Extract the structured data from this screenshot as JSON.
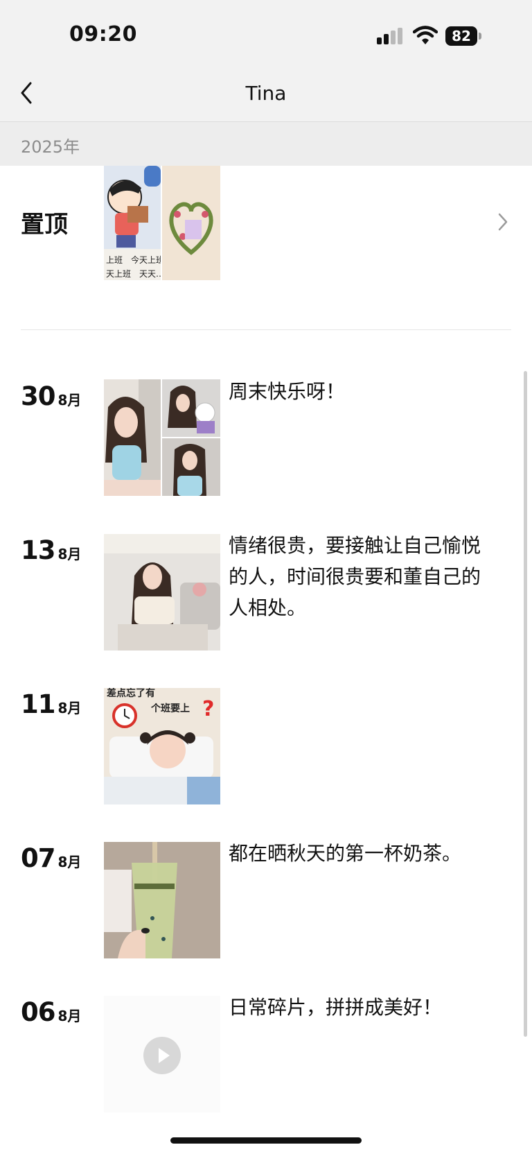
{
  "status_bar": {
    "time": "09:20",
    "battery": "82"
  },
  "nav": {
    "title": "Tina"
  },
  "year_header": "2025年",
  "pinned": {
    "label": "置顶",
    "thumb_text": "上班　今天上班\n天上班　天天…"
  },
  "posts": [
    {
      "day": "30",
      "month": "8月",
      "caption": "周末快乐呀！"
    },
    {
      "day": "13",
      "month": "8月",
      "caption": "情绪很贵，要接触让自己愉悦的人，时间很贵要和董自己的人相处。"
    },
    {
      "day": "11",
      "month": "8月",
      "caption": "",
      "image_text": "差点忘了有个班要上"
    },
    {
      "day": "07",
      "month": "8月",
      "caption": "都在晒秋天的第一杯奶茶。"
    },
    {
      "day": "06",
      "month": "8月",
      "caption": "日常碎片，拼拼成美好！"
    }
  ],
  "colors": {
    "accent_text": "#111111",
    "muted": "#8c8c8c",
    "header_bg": "#f2f2f2",
    "year_bg": "#ededed"
  }
}
